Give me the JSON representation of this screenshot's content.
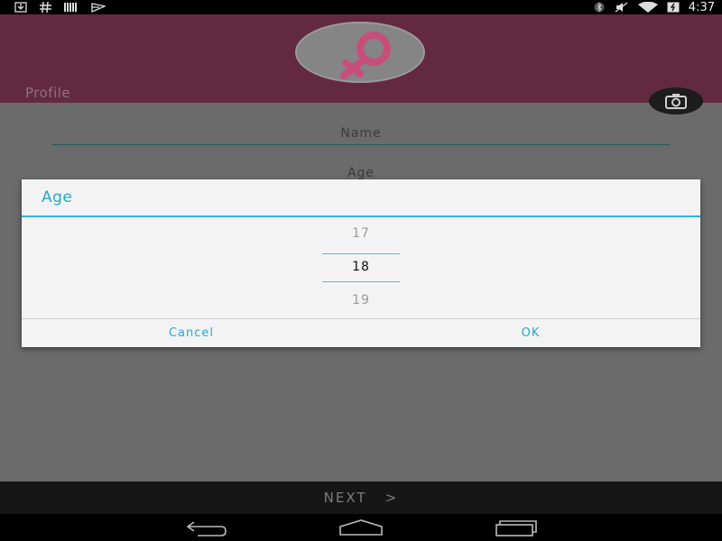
{
  "status_bar": {
    "left_icons": [
      "download-icon",
      "hash-icon",
      "barcode-icon",
      "notification-icon"
    ],
    "right_icons": [
      "bluetooth-icon",
      "mute-icon",
      "wifi-icon",
      "battery-icon"
    ],
    "time": "4:37"
  },
  "header": {
    "title": "Profile",
    "avatar_icon": "female-symbol-icon",
    "camera_icon": "camera-icon"
  },
  "form": {
    "name_placeholder": "Name",
    "age_label": "Age"
  },
  "dialog": {
    "title": "Age",
    "picker": {
      "prev": "17",
      "current": "18",
      "next": "19"
    },
    "cancel_label": "Cancel",
    "ok_label": "OK"
  },
  "footer": {
    "next_label": "NEXT   >"
  },
  "colors": {
    "accent": "#2aa6c8",
    "header": "#632a3f",
    "female_symbol": "#c64f79"
  }
}
